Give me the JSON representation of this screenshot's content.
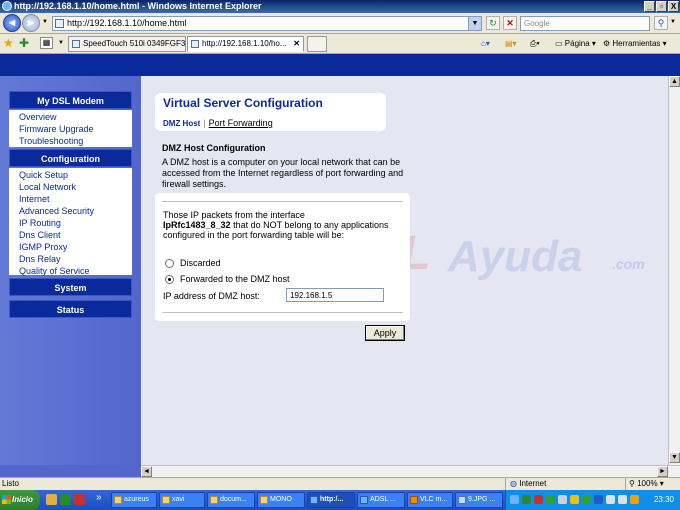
{
  "window": {
    "title": "http://192.168.1.10/home.html - Windows Internet Explorer",
    "minimize": "_",
    "maximize": "▫",
    "close": "X"
  },
  "addressbar": {
    "url": "http://192.168.1.10/home.html",
    "search_placeholder": "Google"
  },
  "tabs": [
    {
      "label": "SpeedTouch 510i  0349FGF3G"
    },
    {
      "label": "http://192.168.1.10/ho..."
    }
  ],
  "commandbar": {
    "page": "Página",
    "tools": "Herramientas"
  },
  "sidebar": {
    "sections": [
      {
        "title": "My DSL Modem",
        "items": [
          "Overview",
          "Firmware Upgrade",
          "Troubleshooting"
        ]
      },
      {
        "title": "Configuration",
        "items": [
          "Quick Setup",
          "Local Network",
          "Internet",
          "Advanced Security",
          "IP Routing",
          "Dns Client",
          "IGMP Proxy",
          "Dns Relay",
          "Quality of Service"
        ]
      },
      {
        "title": "System",
        "items": []
      },
      {
        "title": "Status",
        "items": []
      }
    ]
  },
  "content": {
    "title": "Virtual Server Configuration",
    "tab_active": "DMZ Host",
    "tab_separator": "|",
    "tab_link": "Port Forwarding",
    "section_title": "DMZ Host Configuration",
    "intro": "A DMZ host is a computer on your local network that can be accessed from the Internet regardless of port forwarding and firewall settings.",
    "packets_prefix": "Those IP packets from the interface",
    "interface": "IpRfc1483_8_32",
    "packets_suffix": "that do NOT belong to any applications configured in the port forwarding table will be:",
    "option_discarded": "Discarded",
    "option_forwarded": "Forwarded to the DMZ host",
    "selected_option": "Forwarded to the DMZ host",
    "ip_label": "IP address of DMZ host:",
    "ip_value": "192.168.1.5",
    "apply_label": "Apply"
  },
  "watermark": {
    "text_red": "ADSL",
    "text_blue": "Ayuda",
    "domain": ".com"
  },
  "statusbar": {
    "left": "Listo",
    "zone": "Internet",
    "zoom": "100%"
  },
  "taskbar": {
    "start": "Inicio",
    "more": "»",
    "tasks": [
      "azureus",
      "xavi",
      "docum...",
      "MONO",
      "http:/...",
      "ADSL ...",
      "VLC m...",
      "9.JPG ..."
    ],
    "clock": "23:30"
  }
}
